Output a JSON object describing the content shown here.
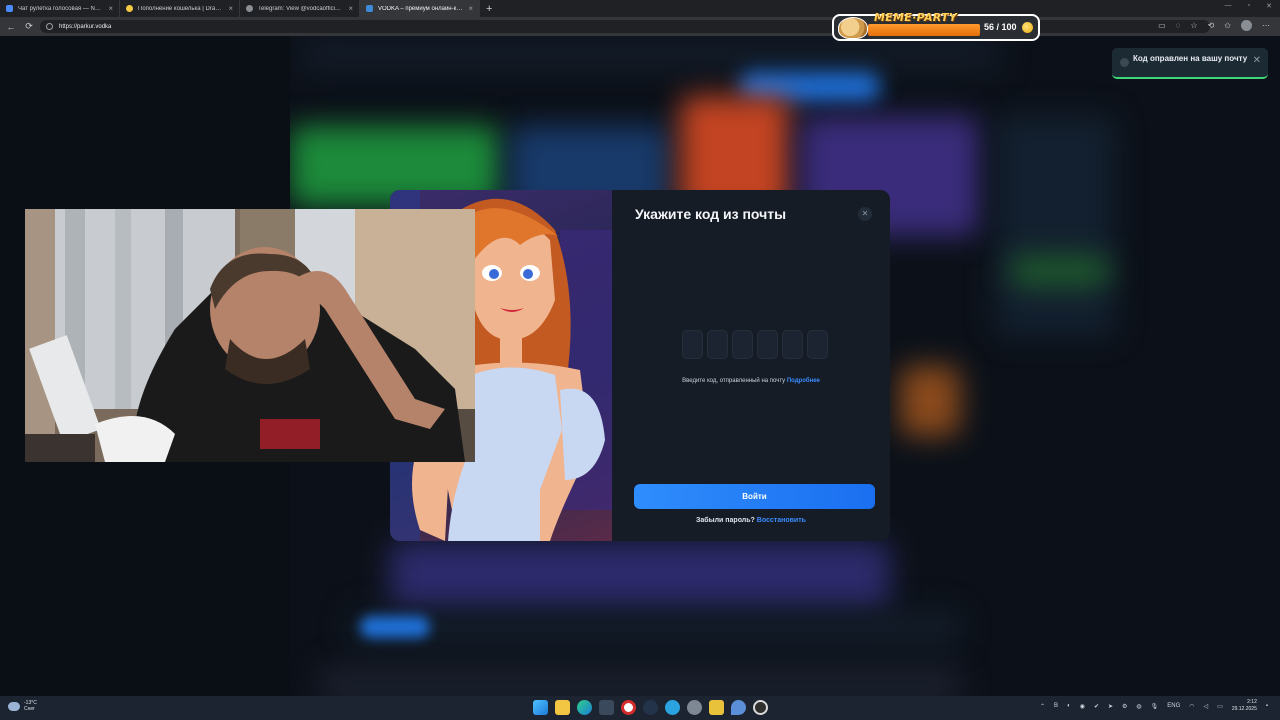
{
  "browser": {
    "tabs": [
      {
        "title": "Чат рулетка голосовая — Nekto",
        "color": "#4a8cff",
        "active": false
      },
      {
        "title": "Пополнение кошелька | Dragon",
        "color": "#f6c945",
        "active": false
      },
      {
        "title": "Telegram: View @vodcaofficialzeno",
        "color": "#8a8f96",
        "active": false
      },
      {
        "title": "VODKA – премиум онлайн-казино",
        "color": "#3d8bd8",
        "active": true
      }
    ],
    "close_glyph": "×",
    "new_tab_glyph": "+",
    "url": "https://parkur.vodka",
    "nav": {
      "back": "←",
      "reload": "⟳"
    }
  },
  "overlay": {
    "title": "MEME·PARTY",
    "count": "56 / 100"
  },
  "toast": {
    "message": "Код оправлен на вашу почту",
    "close": "✕",
    "accent": "#3fd57a"
  },
  "modal": {
    "title": "Укажите код из почты",
    "close": "✕",
    "code_length": 6,
    "hint_text": "Введите код, отправленный на почту ",
    "hint_link": "Подробнее",
    "login_button": "Войти",
    "forgot_text": "Забыли пароль? ",
    "forgot_link": "Восстановить",
    "accent": "#2f8dfc"
  },
  "taskbar": {
    "weather_temp": "-13°C",
    "weather_desc": "Снег",
    "tray_b": "B",
    "language": "ENG",
    "time": "2:12",
    "date": "29.12.2025"
  }
}
